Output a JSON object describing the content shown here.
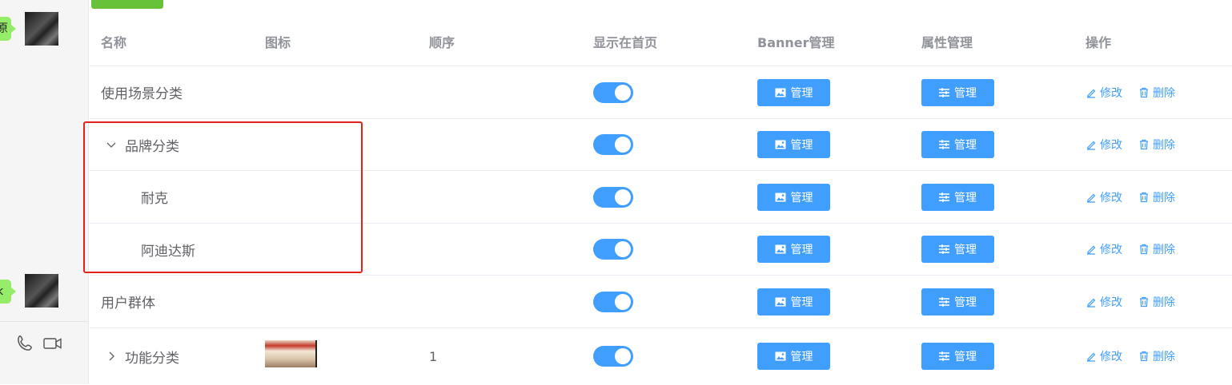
{
  "chat": {
    "bubble_top_text": "原",
    "bubble_bottom_text": "k"
  },
  "table": {
    "headers": {
      "name": "名称",
      "icon": "图标",
      "order": "顺序",
      "show_home": "显示在首页",
      "banner": "Banner管理",
      "attr": "属性管理",
      "ops": "操作"
    },
    "rows": [
      {
        "name": "使用场景分类",
        "order": "",
        "show_home": true,
        "banner": "管理",
        "attr": "管理",
        "edit": "修改",
        "delete": "删除"
      },
      {
        "name": "品牌分类",
        "order": "",
        "show_home": true,
        "banner": "管理",
        "attr": "管理",
        "edit": "修改",
        "delete": "删除",
        "expanded": true
      },
      {
        "name": "耐克",
        "order": "",
        "show_home": true,
        "banner": "管理",
        "attr": "管理",
        "edit": "修改",
        "delete": "删除"
      },
      {
        "name": "阿迪达斯",
        "order": "",
        "show_home": true,
        "banner": "管理",
        "attr": "管理",
        "edit": "修改",
        "delete": "删除"
      },
      {
        "name": "用户群体",
        "order": "",
        "show_home": true,
        "banner": "管理",
        "attr": "管理",
        "edit": "修改",
        "delete": "删除"
      },
      {
        "name": "功能分类",
        "order": "1",
        "show_home": true,
        "banner": "管理",
        "attr": "管理",
        "edit": "修改",
        "delete": "删除",
        "expanded": false
      }
    ]
  },
  "colors": {
    "primary": "#409eff",
    "success": "#67c23a",
    "highlight": "#e2231a",
    "chat_bubble": "#95ec69"
  }
}
